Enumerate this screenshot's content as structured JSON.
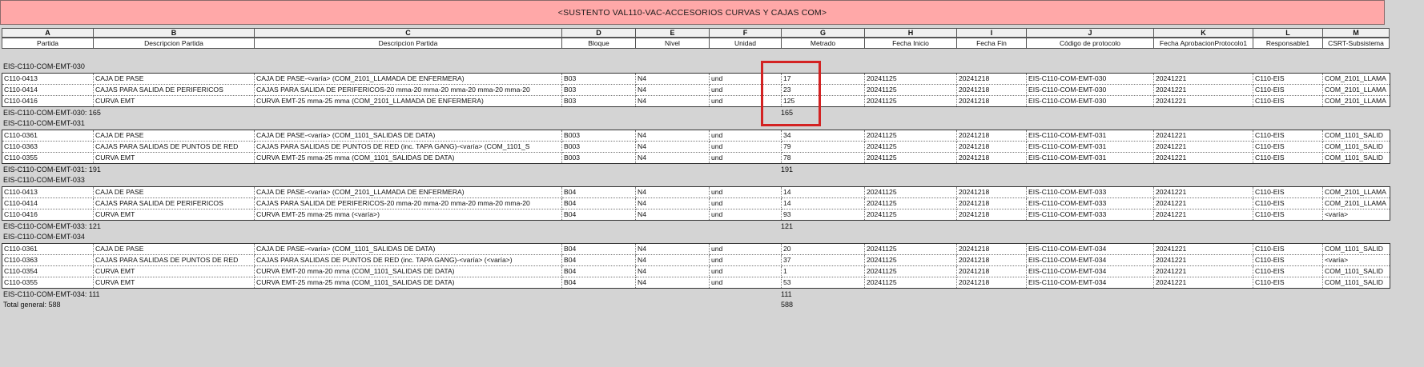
{
  "title": "<SUSTENTO VAL110-VAC-ACCESORIOS CURVAS Y CAJAS COM>",
  "column_letters": [
    "A",
    "B",
    "C",
    "D",
    "E",
    "F",
    "G",
    "H",
    "I",
    "J",
    "K",
    "L",
    "M"
  ],
  "column_headers": [
    "Partida",
    "Descripcion Partida",
    "Descripcion Partida",
    "Bloque",
    "Nivel",
    "Unidad",
    "Metrado",
    "Fecha Inicio",
    "Fecha Fin",
    "Código de protocolo",
    "Fecha AprobacionProtocolo1",
    "Responsable1",
    "CSRT-Subsistema"
  ],
  "groups": [
    {
      "title": "EIS-C110-COM-EMT-030",
      "subtotal_label": "EIS-C110-COM-EMT-030: 165",
      "subtotal_value": "165",
      "rows": [
        [
          "C110-0413",
          "CAJA DE PASE",
          "CAJA DE PASE-<varía> (COM_2101_LLAMADA DE ENFERMERA)",
          "B03",
          "N4",
          "und",
          "17",
          "20241125",
          "20241218",
          "EIS-C110-COM-EMT-030",
          "20241221",
          "C110-EIS",
          "COM_2101_LLAMA"
        ],
        [
          "C110-0414",
          "CAJAS PARA SALIDA DE PERIFERICOS",
          "CAJAS PARA SALIDA DE PERIFERICOS-20 mma-20 mma-20 mma-20 mma-20 mma-20",
          "B03",
          "N4",
          "und",
          "23",
          "20241125",
          "20241218",
          "EIS-C110-COM-EMT-030",
          "20241221",
          "C110-EIS",
          "COM_2101_LLAMA"
        ],
        [
          "C110-0416",
          "CURVA EMT",
          "CURVA EMT-25 mma-25 mma (COM_2101_LLAMADA DE ENFERMERA)",
          "B03",
          "N4",
          "und",
          "125",
          "20241125",
          "20241218",
          "EIS-C110-COM-EMT-030",
          "20241221",
          "C110-EIS",
          "COM_2101_LLAMA"
        ]
      ]
    },
    {
      "title": "EIS-C110-COM-EMT-031",
      "subtotal_label": "EIS-C110-COM-EMT-031: 191",
      "subtotal_value": "191",
      "rows": [
        [
          "C110-0361",
          "CAJA DE PASE",
          "CAJA DE PASE-<varía> (COM_1101_SALIDAS DE DATA)",
          "B003",
          "N4",
          "und",
          "34",
          "20241125",
          "20241218",
          "EIS-C110-COM-EMT-031",
          "20241221",
          "C110-EIS",
          "COM_1101_SALID"
        ],
        [
          "C110-0363",
          "CAJAS PARA SALIDAS DE PUNTOS DE RED",
          "CAJAS PARA SALIDAS DE PUNTOS DE RED (inc. TAPA GANG)-<varía> (COM_1101_S",
          "B003",
          "N4",
          "und",
          "79",
          "20241125",
          "20241218",
          "EIS-C110-COM-EMT-031",
          "20241221",
          "C110-EIS",
          "COM_1101_SALID"
        ],
        [
          "C110-0355",
          "CURVA EMT",
          "CURVA EMT-25 mma-25 mma (COM_1101_SALIDAS DE DATA)",
          "B003",
          "N4",
          "und",
          "78",
          "20241125",
          "20241218",
          "EIS-C110-COM-EMT-031",
          "20241221",
          "C110-EIS",
          "COM_1101_SALID"
        ]
      ]
    },
    {
      "title": "EIS-C110-COM-EMT-033",
      "subtotal_label": "EIS-C110-COM-EMT-033: 121",
      "subtotal_value": "121",
      "rows": [
        [
          "C110-0413",
          "CAJA DE PASE",
          "CAJA DE PASE-<varía> (COM_2101_LLAMADA DE ENFERMERA)",
          "B04",
          "N4",
          "und",
          "14",
          "20241125",
          "20241218",
          "EIS-C110-COM-EMT-033",
          "20241221",
          "C110-EIS",
          "COM_2101_LLAMA"
        ],
        [
          "C110-0414",
          "CAJAS PARA SALIDA DE PERIFERICOS",
          "CAJAS PARA SALIDA DE PERIFERICOS-20 mma-20 mma-20 mma-20 mma-20 mma-20",
          "B04",
          "N4",
          "und",
          "14",
          "20241125",
          "20241218",
          "EIS-C110-COM-EMT-033",
          "20241221",
          "C110-EIS",
          "COM_2101_LLAMA"
        ],
        [
          "C110-0416",
          "CURVA EMT",
          "CURVA EMT-25 mma-25 mma (<varía>)",
          "B04",
          "N4",
          "und",
          "93",
          "20241125",
          "20241218",
          "EIS-C110-COM-EMT-033",
          "20241221",
          "C110-EIS",
          "<varía>"
        ]
      ]
    },
    {
      "title": "EIS-C110-COM-EMT-034",
      "subtotal_label": "EIS-C110-COM-EMT-034: 111",
      "subtotal_value": "111",
      "rows": [
        [
          "C110-0361",
          "CAJA DE PASE",
          "CAJA DE PASE-<varía> (COM_1101_SALIDAS DE DATA)",
          "B04",
          "N4",
          "und",
          "20",
          "20241125",
          "20241218",
          "EIS-C110-COM-EMT-034",
          "20241221",
          "C110-EIS",
          "COM_1101_SALID"
        ],
        [
          "C110-0363",
          "CAJAS PARA SALIDAS DE PUNTOS DE RED",
          "CAJAS PARA SALIDAS DE PUNTOS DE RED (inc. TAPA GANG)-<varía> (<varía>)",
          "B04",
          "N4",
          "und",
          "37",
          "20241125",
          "20241218",
          "EIS-C110-COM-EMT-034",
          "20241221",
          "C110-EIS",
          "<varía>"
        ],
        [
          "C110-0354",
          "CURVA EMT",
          "CURVA EMT-20 mma-20 mma (COM_1101_SALIDAS DE DATA)",
          "B04",
          "N4",
          "und",
          "1",
          "20241125",
          "20241218",
          "EIS-C110-COM-EMT-034",
          "20241221",
          "C110-EIS",
          "COM_1101_SALID"
        ],
        [
          "C110-0355",
          "CURVA EMT",
          "CURVA EMT-25 mma-25 mma (COM_1101_SALIDAS DE DATA)",
          "B04",
          "N4",
          "und",
          "53",
          "20241125",
          "20241218",
          "EIS-C110-COM-EMT-034",
          "20241221",
          "C110-EIS",
          "COM_1101_SALID"
        ]
      ]
    }
  ],
  "grand_total_label": "Total general: 588",
  "grand_total_value": "588",
  "colors": {
    "banner": "#ffa8a8",
    "highlight": "#d32222",
    "background": "#d4d4d4"
  }
}
